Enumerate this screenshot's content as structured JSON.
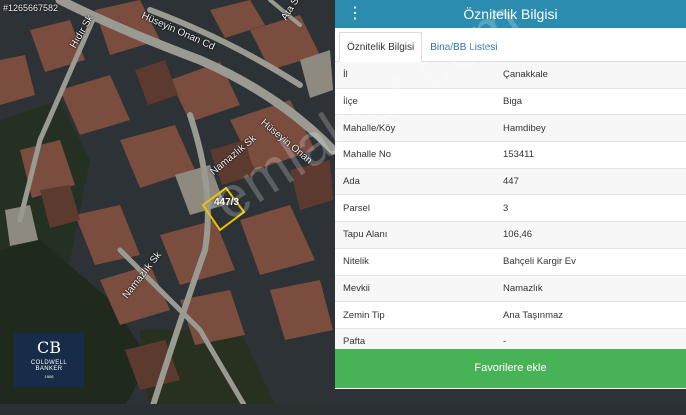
{
  "map": {
    "listing_id": "#1265667582",
    "streets": [
      {
        "label": "Hıdır Sk",
        "name": "street-label-hidir"
      },
      {
        "label": "Hüseyin Onan Cd",
        "name": "street-label-huseyin-onan-upper"
      },
      {
        "label": "Hüseyin Onan",
        "name": "street-label-huseyin-onan-lower"
      },
      {
        "label": "Namazlık Sk",
        "name": "street-label-namazlik-upper"
      },
      {
        "label": "Namazlık Sk",
        "name": "street-label-namazlik-lower"
      },
      {
        "label": "Ata Sk",
        "name": "street-label-ata"
      }
    ],
    "parcel_label": "447/3",
    "watermark": "emlakjet.com",
    "logo": {
      "mark": "CB",
      "line1": "COLDWELL",
      "line2": "BANKER",
      "line3": "1906"
    }
  },
  "panel": {
    "title": "Öznitelik Bilgisi",
    "tabs": [
      {
        "label": "Öznitelik Bilgisi",
        "active": true
      },
      {
        "label": "Bina/BB Listesi",
        "active": false
      }
    ],
    "rows": [
      {
        "key": "İl",
        "value": "Çanakkale"
      },
      {
        "key": "İlçe",
        "value": "Biga"
      },
      {
        "key": "Mahalle/Köy",
        "value": "Hamdibey"
      },
      {
        "key": "Mahalle No",
        "value": "153411"
      },
      {
        "key": "Ada",
        "value": "447"
      },
      {
        "key": "Parsel",
        "value": "3"
      },
      {
        "key": "Tapu Alanı",
        "value": "106,46"
      },
      {
        "key": "Nitelik",
        "value": "Bahçeli Kargir Ev"
      },
      {
        "key": "Mevkii",
        "value": "Namazlık"
      },
      {
        "key": "Zemin Tip",
        "value": "Ana Taşınmaz"
      },
      {
        "key": "Pafta",
        "value": "-"
      }
    ],
    "favorite_button": "Favorilere ekle"
  },
  "colors": {
    "header": "#2b8cb0",
    "tab_link": "#2a6fb2",
    "favorite_button": "#48b257",
    "parcel_outline": "#f2c200"
  }
}
